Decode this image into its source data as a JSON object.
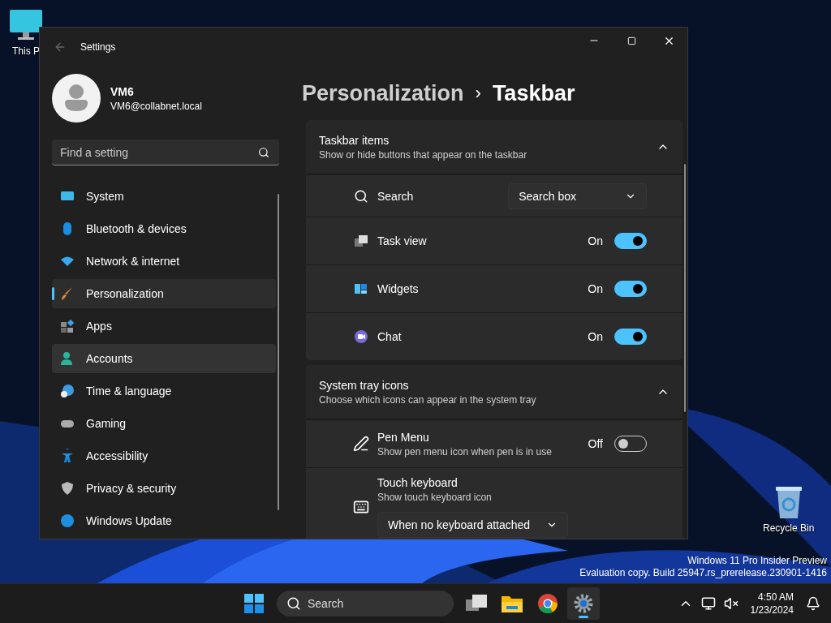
{
  "desktop_icons": [
    {
      "label": "This P"
    },
    {
      "label": "Recycle Bin"
    }
  ],
  "window": {
    "title": "Settings"
  },
  "profile": {
    "name": "VM6",
    "email": "VM6@collabnet.local"
  },
  "search": {
    "placeholder": "Find a setting"
  },
  "nav_items": [
    {
      "label": "System",
      "selected": false,
      "hovered": false
    },
    {
      "label": "Bluetooth & devices",
      "selected": false,
      "hovered": false
    },
    {
      "label": "Network & internet",
      "selected": false,
      "hovered": false
    },
    {
      "label": "Personalization",
      "selected": true,
      "hovered": false
    },
    {
      "label": "Apps",
      "selected": false,
      "hovered": false
    },
    {
      "label": "Accounts",
      "selected": false,
      "hovered": true
    },
    {
      "label": "Time & language",
      "selected": false,
      "hovered": false
    },
    {
      "label": "Gaming",
      "selected": false,
      "hovered": false
    },
    {
      "label": "Accessibility",
      "selected": false,
      "hovered": false
    },
    {
      "label": "Privacy & security",
      "selected": false,
      "hovered": false
    },
    {
      "label": "Windows Update",
      "selected": false,
      "hovered": false
    }
  ],
  "breadcrumb": {
    "parent": "Personalization",
    "separator": "›",
    "current": "Taskbar"
  },
  "sections": [
    {
      "title": "Taskbar items",
      "subtitle": "Show or hide buttons that appear on the taskbar",
      "expanded": true,
      "rows": [
        {
          "kind": "dropdown",
          "label": "Search",
          "value": "Search box"
        },
        {
          "kind": "toggle",
          "label": "Task view",
          "state": "On",
          "on": true
        },
        {
          "kind": "toggle",
          "label": "Widgets",
          "state": "On",
          "on": true
        },
        {
          "kind": "toggle",
          "label": "Chat",
          "state": "On",
          "on": true
        }
      ]
    },
    {
      "title": "System tray icons",
      "subtitle": "Choose which icons can appear in the system tray",
      "expanded": true,
      "rows": [
        {
          "kind": "toggle",
          "label": "Pen Menu",
          "description": "Show pen menu icon when pen is in use",
          "state": "Off",
          "on": false
        },
        {
          "kind": "dropdown_below",
          "label": "Touch keyboard",
          "description": "Show touch keyboard icon",
          "value": "When no keyboard attached"
        }
      ]
    }
  ],
  "watermark": [
    "Windows 11 Pro Insider Preview",
    "Evaluation copy. Build 25947.rs_prerelease.230901-1416"
  ],
  "taskbar": {
    "search_placeholder": "Search",
    "pinned_apps": [
      {
        "selected": false
      },
      {
        "selected": false
      },
      {
        "selected": false
      },
      {
        "selected": true
      }
    ],
    "time": "4:50 AM",
    "date": "1/23/2024"
  }
}
